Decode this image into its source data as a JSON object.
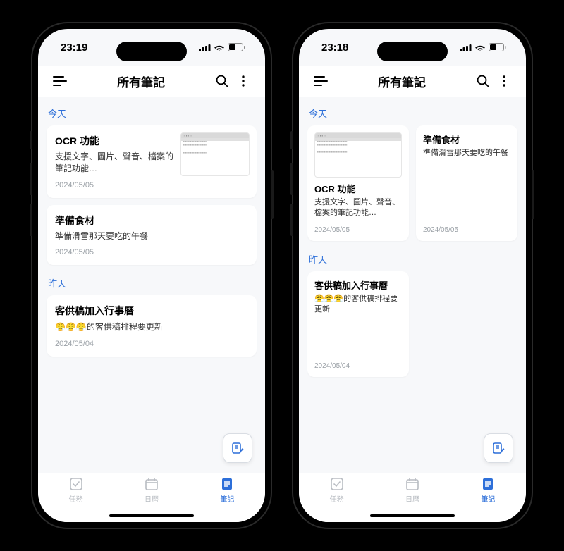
{
  "phones": [
    {
      "status": {
        "time": "23:19"
      },
      "header": {
        "title": "所有筆記"
      },
      "sections": [
        {
          "label": "今天",
          "cards": [
            {
              "title": "OCR 功能",
              "desc": "支援文字、圖片、聲音、檔案的筆記功能…",
              "date": "2024/05/05",
              "has_thumb": true
            },
            {
              "title": "準備食材",
              "desc": "準備滑雪那天要吃的午餐",
              "date": "2024/05/05"
            }
          ]
        },
        {
          "label": "昨天",
          "cards": [
            {
              "title": "客供稿加入行事曆",
              "desc": "😤😤😤的客供稿排程要更新",
              "date": "2024/05/04"
            }
          ]
        }
      ]
    },
    {
      "status": {
        "time": "23:18"
      },
      "header": {
        "title": "所有筆記"
      },
      "sections": [
        {
          "label": "今天",
          "grid": [
            {
              "title": "OCR 功能",
              "desc": "支援文字、圖片、聲音、檔案的筆記功能…",
              "date": "2024/05/05",
              "thumb_top": true
            },
            {
              "title": "準備食材",
              "desc": "準備滑雪那天要吃的午餐",
              "date": "2024/05/05"
            }
          ]
        },
        {
          "label": "昨天",
          "grid": [
            {
              "title": "客供稿加入行事曆",
              "desc": "😤😤😤的客供稿排程要更新",
              "date": "2024/05/04",
              "tall": true
            }
          ]
        }
      ]
    }
  ],
  "tabs": [
    {
      "label": "任務",
      "icon": "task"
    },
    {
      "label": "日曆",
      "icon": "calendar"
    },
    {
      "label": "筆記",
      "icon": "note",
      "active": true
    }
  ]
}
